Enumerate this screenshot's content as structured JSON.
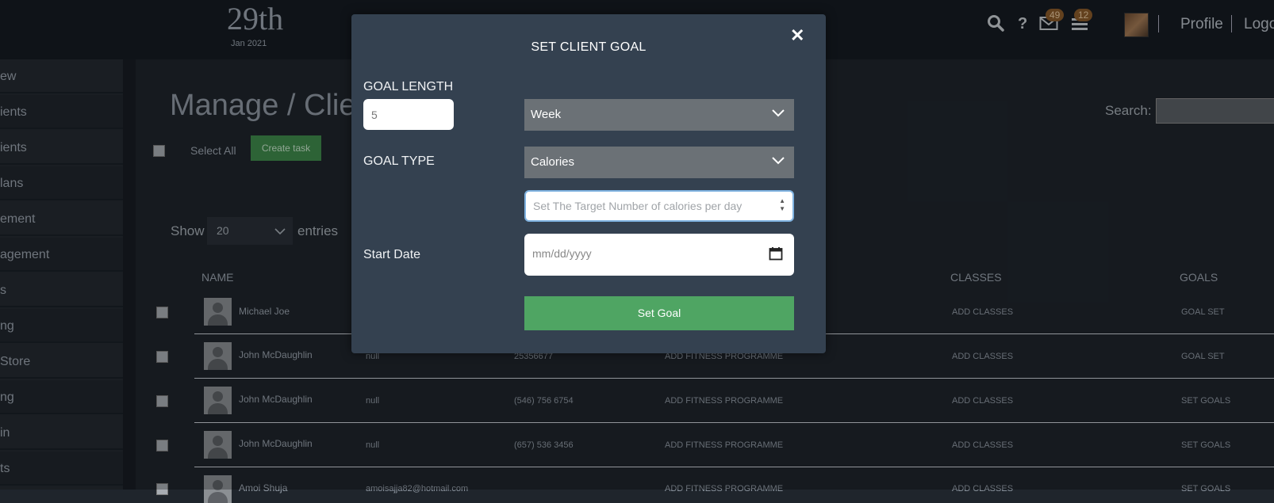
{
  "header": {
    "day": "29th",
    "month_year": "Jan 2021",
    "mail_count": "49",
    "tasks_count": "12",
    "profile_label": "Profile",
    "logout_label": "Logo"
  },
  "sidebar": {
    "items": [
      {
        "label": "ew"
      },
      {
        "label": "ients"
      },
      {
        "label": "ients"
      },
      {
        "label": "lans"
      },
      {
        "label": "ement"
      },
      {
        "label": "agement"
      },
      {
        "label": "s"
      },
      {
        "label": "ng"
      },
      {
        "label": "Store"
      },
      {
        "label": "ng"
      },
      {
        "label": "in"
      },
      {
        "label": "ts"
      }
    ]
  },
  "main": {
    "title": "Manage / Clien",
    "select_all": "Select All",
    "create_task": "Create task",
    "search_label": "Search:",
    "show_label": "Show",
    "entries_value": "20",
    "entries_label": "entries",
    "columns": [
      "NAME",
      "CLASSES",
      "GOALS"
    ],
    "rows": [
      {
        "name": "Michael Joe",
        "col2": "",
        "col3": "",
        "program": "",
        "classes": "ADD CLASSES",
        "goals": "GOAL SET"
      },
      {
        "name": "John McDaughlin",
        "col2": "null",
        "col3": "25356677",
        "program": "ADD FITNESS PROGRAMME",
        "classes": "ADD CLASSES",
        "goals": "GOAL SET"
      },
      {
        "name": "John McDaughlin",
        "col2": "null",
        "col3": "(546) 756 6754",
        "program": "ADD FITNESS PROGRAMME",
        "classes": "ADD CLASSES",
        "goals": "SET GOALS"
      },
      {
        "name": "John McDaughlin",
        "col2": "null",
        "col3": "(657) 536 3456",
        "program": "ADD FITNESS PROGRAMME",
        "classes": "ADD CLASSES",
        "goals": "SET GOALS"
      },
      {
        "name": "Amoi Shuja",
        "col2": "amoisajja82@hotmail.com",
        "col3": "",
        "program": "ADD FITNESS PROGRAMME",
        "classes": "ADD CLASSES",
        "goals": "SET GOALS"
      }
    ]
  },
  "modal": {
    "title": "SET CLIENT GOAL",
    "goal_length_label": "GOAL LENGTH",
    "goal_length_value": "5",
    "period_value": "Week",
    "goal_type_label": "GOAL TYPE",
    "goal_type_value": "Calories",
    "target_placeholder": "Set The Target Number of calories per day",
    "start_date_label": "Start Date",
    "date_placeholder": "mm/dd/yyyy",
    "submit_label": "Set Goal"
  },
  "colors": {
    "accent_green": "#4fa563",
    "modal_bg": "#344150",
    "badge": "#8a5a2a"
  }
}
